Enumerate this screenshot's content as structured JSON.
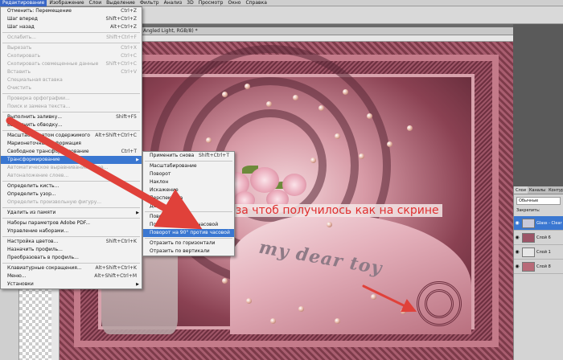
{
  "menubar": {
    "items": [
      "Редактирование",
      "Изображение",
      "Слои",
      "Выделение",
      "Фильтр",
      "Анализ",
      "3D",
      "Просмотр",
      "Окно",
      "Справка"
    ]
  },
  "document": {
    "tab_title": "Angled Light, RGB/8) *"
  },
  "edit_menu": {
    "items": [
      {
        "label": "Отменить: Перемещение",
        "shortcut": "Ctrl+Z",
        "state": "normal"
      },
      {
        "label": "Шаг вперед",
        "shortcut": "Shift+Ctrl+Z",
        "state": "normal"
      },
      {
        "label": "Шаг назад",
        "shortcut": "Alt+Ctrl+Z",
        "state": "normal"
      },
      {
        "sep": true
      },
      {
        "label": "Ослабить...",
        "shortcut": "Shift+Ctrl+F",
        "state": "disabled"
      },
      {
        "sep": true
      },
      {
        "label": "Вырезать",
        "shortcut": "Ctrl+X",
        "state": "disabled"
      },
      {
        "label": "Скопировать",
        "shortcut": "Ctrl+C",
        "state": "disabled"
      },
      {
        "label": "Скопировать совмещенные данные",
        "shortcut": "Shift+Ctrl+C",
        "state": "disabled"
      },
      {
        "label": "Вставить",
        "shortcut": "Ctrl+V",
        "state": "disabled"
      },
      {
        "label": "Специальная вставка",
        "shortcut": "",
        "state": "disabled"
      },
      {
        "label": "Очистить",
        "shortcut": "",
        "state": "disabled"
      },
      {
        "sep": true
      },
      {
        "label": "Проверка орфографии...",
        "shortcut": "",
        "state": "disabled"
      },
      {
        "label": "Поиск и замена текста...",
        "shortcut": "",
        "state": "disabled"
      },
      {
        "sep": true
      },
      {
        "label": "Выполнить заливку...",
        "shortcut": "Shift+F5",
        "state": "normal"
      },
      {
        "label": "Выполнить обводку...",
        "shortcut": "",
        "state": "normal"
      },
      {
        "sep": true
      },
      {
        "label": "Масштаб с учетом содержимого",
        "shortcut": "Alt+Shift+Ctrl+C",
        "state": "normal"
      },
      {
        "label": "Марионеточная деформация",
        "shortcut": "",
        "state": "normal"
      },
      {
        "label": "Свободное трансформирование",
        "shortcut": "Ctrl+T",
        "state": "normal"
      },
      {
        "label": "Трансформирование",
        "shortcut": "",
        "state": "highlight",
        "submenu": true
      },
      {
        "label": "Автоматическое выравнивание слоев...",
        "shortcut": "",
        "state": "disabled"
      },
      {
        "label": "Автоналожение слоев...",
        "shortcut": "",
        "state": "disabled"
      },
      {
        "sep": true
      },
      {
        "label": "Определить кисть...",
        "shortcut": "",
        "state": "normal"
      },
      {
        "label": "Определить узор...",
        "shortcut": "",
        "state": "normal"
      },
      {
        "label": "Определить произвольную фигуру...",
        "shortcut": "",
        "state": "disabled"
      },
      {
        "sep": true
      },
      {
        "label": "Удалить из памяти",
        "shortcut": "",
        "state": "normal",
        "submenu": true
      },
      {
        "sep": true
      },
      {
        "label": "Наборы параметров Adobe PDF...",
        "shortcut": "",
        "state": "normal"
      },
      {
        "label": "Управление наборами...",
        "shortcut": "",
        "state": "normal"
      },
      {
        "sep": true
      },
      {
        "label": "Настройка цветов...",
        "shortcut": "Shift+Ctrl+K",
        "state": "normal"
      },
      {
        "label": "Назначить профиль...",
        "shortcut": "",
        "state": "normal"
      },
      {
        "label": "Преобразовать в профиль...",
        "shortcut": "",
        "state": "normal"
      },
      {
        "sep": true
      },
      {
        "label": "Клавиатурные сокращения...",
        "shortcut": "Alt+Shift+Ctrl+K",
        "state": "normal"
      },
      {
        "label": "Меню...",
        "shortcut": "Alt+Shift+Ctrl+M",
        "state": "normal"
      },
      {
        "label": "Установки",
        "shortcut": "",
        "state": "normal",
        "submenu": true
      }
    ]
  },
  "transform_submenu": {
    "items": [
      {
        "label": "Применить снова",
        "shortcut": "Shift+Ctrl+T",
        "state": "normal"
      },
      {
        "sep": true
      },
      {
        "label": "Масштабирование",
        "shortcut": "",
        "state": "normal"
      },
      {
        "label": "Поворот",
        "shortcut": "",
        "state": "normal"
      },
      {
        "label": "Наклон",
        "shortcut": "",
        "state": "normal"
      },
      {
        "label": "Искажение",
        "shortcut": "",
        "state": "normal"
      },
      {
        "label": "Перспектива",
        "shortcut": "",
        "state": "normal"
      },
      {
        "label": "Деформация",
        "shortcut": "",
        "state": "normal"
      },
      {
        "sep": true
      },
      {
        "label": "Поворот на 180°",
        "shortcut": "",
        "state": "normal"
      },
      {
        "label": "Поворот на 90° по часовой",
        "shortcut": "",
        "state": "normal"
      },
      {
        "label": "Поворот на 90° против часовой",
        "shortcut": "",
        "state": "highlight"
      },
      {
        "sep": true
      },
      {
        "label": "Отразить по горизонтали",
        "shortcut": "",
        "state": "normal"
      },
      {
        "label": "Отразить по вертикали",
        "shortcut": "",
        "state": "normal"
      }
    ]
  },
  "annotation": {
    "text": "2 раза чтоб получилось как на скрине"
  },
  "artwork": {
    "watermark": "my dear toy"
  },
  "layers_panel": {
    "tabs": [
      "Слои",
      "Каналы",
      "Контуры"
    ],
    "blend_mode": "Обычные",
    "lock_label": "Закрепить:",
    "layers": [
      {
        "name": "Glass - Clear",
        "selected": true,
        "thumb_color": "#c9c9d9"
      },
      {
        "name": "Слой 6",
        "selected": false,
        "thumb_color": "#9c5567"
      },
      {
        "name": "Слой 1",
        "selected": false,
        "thumb_color": "#e7e7e7"
      },
      {
        "name": "Слой 8",
        "selected": false,
        "thumb_color": "#b86a78"
      }
    ]
  },
  "colors": {
    "highlight": "#3a77d1",
    "annotation_red": "#e03030"
  }
}
